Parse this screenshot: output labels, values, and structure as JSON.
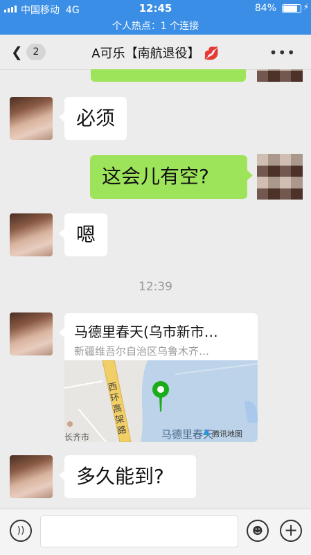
{
  "status_bar": {
    "carrier": "中国移动",
    "network": "4G",
    "time": "12:45",
    "battery": "84%",
    "hotspot": "个人热点：1 个连接"
  },
  "nav": {
    "back_icon": "chevron-left-icon",
    "unread_count": "2",
    "title": "A可乐【南航退役】",
    "title_emoji": "💋",
    "more_icon": "more-dots-icon"
  },
  "messages": [
    {
      "side": "left",
      "text": "必须"
    },
    {
      "side": "right",
      "text": "这会儿有空?"
    },
    {
      "side": "left",
      "text": "嗯"
    },
    {
      "timestamp": "12:39"
    },
    {
      "side": "left",
      "type": "location",
      "name": "马德里春天(乌市新市…",
      "address": "新疆维吾尔自治区乌鲁木齐…",
      "map_road": "西环高架路",
      "map_place": "马德里春天",
      "map_credit": "腾讯地图",
      "map_side": "长齐市"
    },
    {
      "side": "left",
      "text": "多久能到?"
    }
  ],
  "input_bar": {
    "voice_icon": "voice-icon",
    "emoji_icon": "emoji-icon",
    "plus_icon": "plus-icon",
    "placeholder": ""
  },
  "colors": {
    "status_bar": "#3a8ee6",
    "sent_bubble": "#9ee45b",
    "received_bubble": "#ffffff",
    "background": "#ececec",
    "map_pin": "#1aad19"
  }
}
